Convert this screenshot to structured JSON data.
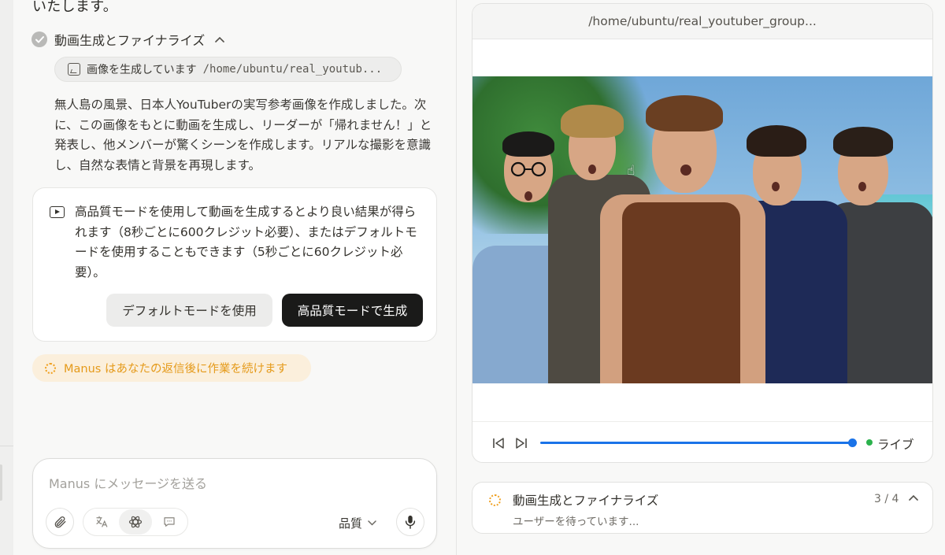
{
  "chat": {
    "top_text": "いたします。",
    "step": {
      "title": "動画生成とファイナライズ"
    },
    "tool": {
      "action": "画像を生成しています",
      "path": "/home/ubuntu/real_youtub..."
    },
    "paragraph": "無人島の風景、日本人YouTuberの実写参考画像を作成しました。次に、この画像をもとに動画を生成し、リーダーが「帰れません！」と発表し、他メンバーが驚くシーンを作成します。リアルな撮影を意識し、自然な表情と背景を再現します。",
    "card": {
      "text": "高品質モードを使用して動画を生成するとより良い結果が得られます（8秒ごとに600クレジット必要）、またはデフォルトモードを使用することもできます（5秒ごとに60クレジット必要）。",
      "default_button": "デフォルトモードを使用",
      "hq_button": "高品質モードで生成"
    },
    "status": "Manus はあなたの返信後に作業を続けます",
    "input": {
      "placeholder": "Manus にメッセージを送る",
      "quality_label": "品質"
    }
  },
  "viewer": {
    "title": "/home/ubuntu/real_youtuber_group...",
    "progress": 0.99,
    "live_label": "ライブ"
  },
  "task": {
    "title": "動画生成とファイナライズ",
    "subtitle": "ユーザーを待っています...",
    "count": "3 / 4"
  },
  "icons": {
    "check": "check-circle-icon",
    "image_tool": "image-icon",
    "play": "video-icon",
    "attach": "paperclip-icon",
    "mic": "microphone-icon",
    "prev": "skip-back-icon",
    "next": "skip-forward-icon"
  },
  "colors": {
    "accent_blue": "#1a73e8",
    "live_green": "#2bb24c",
    "status_orange": "#e59a1a",
    "primary_button": "#1a1a19"
  }
}
